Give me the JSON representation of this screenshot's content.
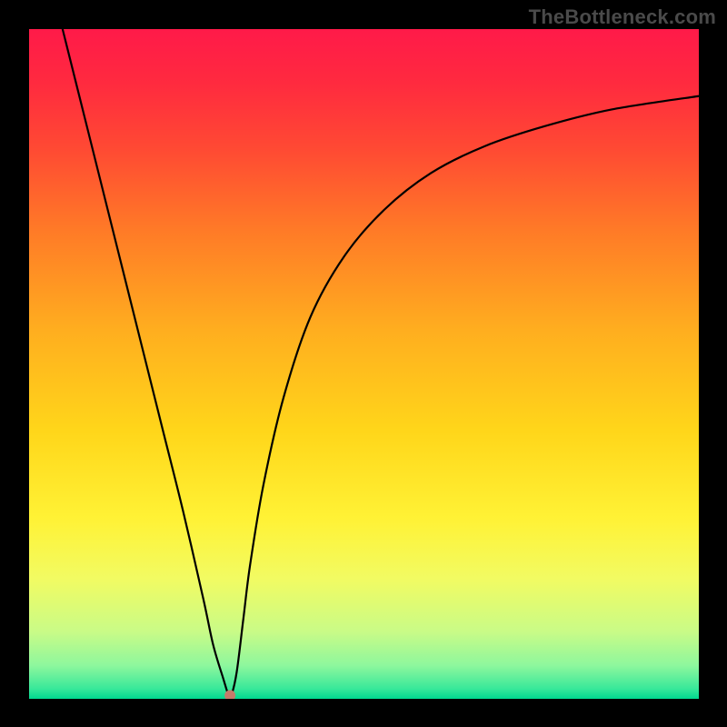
{
  "watermark": "TheBottleneck.com",
  "chart_data": {
    "type": "line",
    "title": "",
    "xlabel": "",
    "ylabel": "",
    "xlim": [
      0,
      100
    ],
    "ylim": [
      0,
      100
    ],
    "grid": false,
    "legend": false,
    "background_gradient": {
      "stops": [
        {
          "offset": 0.0,
          "color": "#ff1a49"
        },
        {
          "offset": 0.08,
          "color": "#ff2a3f"
        },
        {
          "offset": 0.18,
          "color": "#ff4a33"
        },
        {
          "offset": 0.3,
          "color": "#ff7a27"
        },
        {
          "offset": 0.45,
          "color": "#ffae1f"
        },
        {
          "offset": 0.6,
          "color": "#ffd61a"
        },
        {
          "offset": 0.73,
          "color": "#fff235"
        },
        {
          "offset": 0.82,
          "color": "#f2fb62"
        },
        {
          "offset": 0.9,
          "color": "#c9fb87"
        },
        {
          "offset": 0.95,
          "color": "#8ef79d"
        },
        {
          "offset": 0.985,
          "color": "#38e89a"
        },
        {
          "offset": 1.0,
          "color": "#00d890"
        }
      ]
    },
    "series": [
      {
        "name": "bottleneck-curve",
        "color": "#000000",
        "x": [
          5,
          8,
          11,
          14,
          17,
          20,
          23,
          26,
          27.5,
          29,
          29.8,
          30.2,
          31,
          32,
          33,
          35,
          38,
          42,
          47,
          53,
          60,
          68,
          77,
          87,
          100
        ],
        "y": [
          100,
          88,
          76,
          64,
          52,
          40,
          28,
          15,
          8,
          3,
          0.5,
          0.5,
          4,
          12,
          20,
          32,
          45,
          57,
          66,
          73,
          78.5,
          82.5,
          85.5,
          88,
          90
        ]
      }
    ],
    "marker": {
      "x": 30,
      "y": 0.5,
      "color": "#c57b6a",
      "radius": 6
    }
  }
}
